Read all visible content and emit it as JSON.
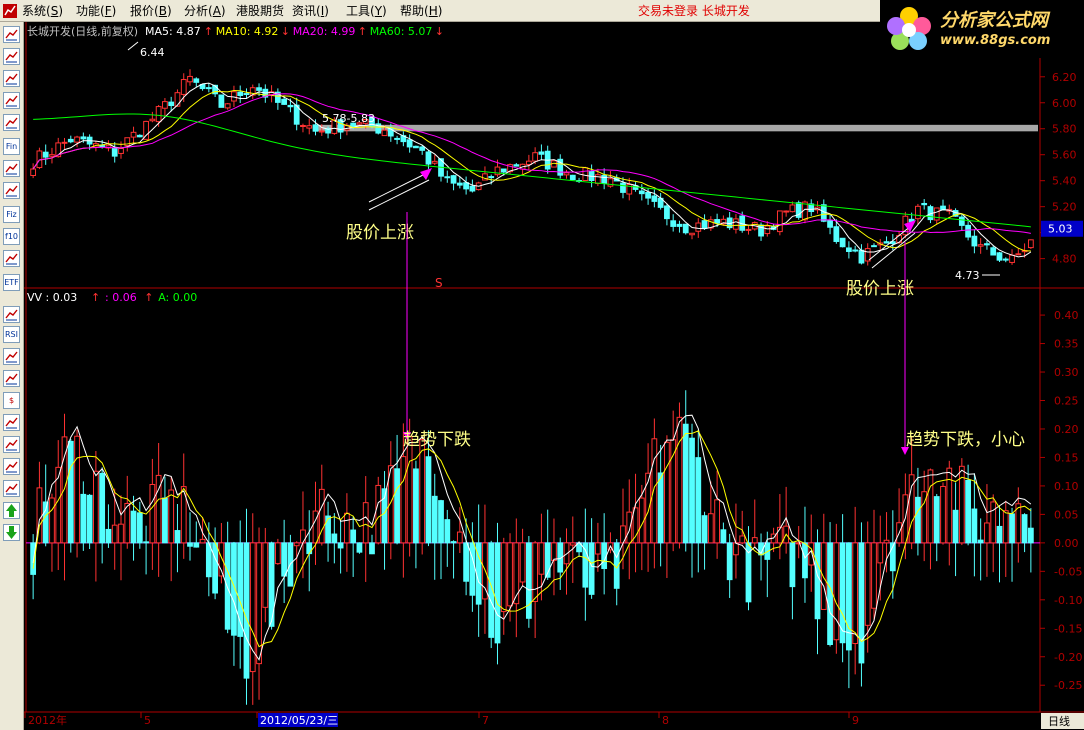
{
  "menu": {
    "items": [
      {
        "label": "系统",
        "key": "S"
      },
      {
        "label": "功能",
        "key": "F"
      },
      {
        "label": "报价",
        "key": "B"
      },
      {
        "label": "分析",
        "key": "A"
      },
      {
        "label": "港股期货",
        "key": ""
      },
      {
        "label": "资讯",
        "key": "I"
      },
      {
        "label": "工具",
        "key": "Y"
      },
      {
        "label": "帮助",
        "key": "H"
      }
    ],
    "status": "交易未登录  长城开发"
  },
  "logo": {
    "title": "分析家公式网",
    "url": "www.88gs.com"
  },
  "toolbar": {
    "icons": [
      "grid-icon",
      "list-icon",
      "line-chart-icon",
      "candle-icon",
      "layers-icon",
      "fin-icon",
      "f10-icon",
      "report-icon",
      "fiz-icon",
      "f10b-icon",
      "search-icon",
      "etf-icon",
      "wave-icon",
      "rsi-icon",
      "refresh-icon",
      "table-icon",
      "dollar-icon",
      "ticket-icon",
      "export-icon",
      "pencil-icon",
      "move-icon",
      "up-arrow-icon",
      "down-arrow-icon"
    ],
    "labels": [
      "",
      "",
      "",
      "",
      "",
      "Fin",
      "",
      "",
      "Fiz",
      "f10",
      "",
      "ETF",
      "",
      "RSI",
      "",
      "",
      "$",
      "",
      "",
      "",
      "",
      "",
      ""
    ]
  },
  "price_panel": {
    "title": "长城开发(日线,前复权)",
    "ma": [
      {
        "label": "MA5: 4.87",
        "arrow": "↑",
        "color": "#ffffff"
      },
      {
        "label": "MA10: 4.92",
        "arrow": "↓",
        "color": "#ffff00"
      },
      {
        "label": "MA20: 4.99",
        "arrow": "↑",
        "color": "#ff00ff"
      },
      {
        "label": "MA60: 5.07",
        "arrow": "↓",
        "color": "#00ff00"
      }
    ],
    "yticks": [
      "6.20",
      "6.00",
      "5.80",
      "5.60",
      "5.40",
      "5.20",
      "5.00",
      "4.80"
    ],
    "ylim": [
      4.62,
      6.36
    ],
    "current_price": "5.03",
    "high_label": "6.44",
    "low_label": "4.73",
    "range_label": "5.78-5.83",
    "annotation_rise_1": "股价上涨",
    "annotation_rise_2": "股价上涨",
    "marker": "S"
  },
  "indicator_panel": {
    "title_parts": [
      {
        "text": "VV  : 0.03",
        "arrow": "↑",
        "color": "#ffffff"
      },
      {
        "text": ": 0.06",
        "arrow": "↑",
        "color": "#ff00ff"
      },
      {
        "text": "A: 0.00",
        "arrow": "",
        "color": "#00ff00"
      }
    ],
    "yticks": [
      "0.40",
      "0.35",
      "0.30",
      "0.25",
      "0.20",
      "0.15",
      "0.10",
      "0.05",
      "0.00",
      "-0.05",
      "-0.10",
      "-0.15",
      "-0.20",
      "-0.25"
    ],
    "ylim": [
      -0.29,
      0.43
    ],
    "annotation_fall_1": "趋势下跌",
    "annotation_fall_2": "趋势下跌，小心"
  },
  "xaxis": {
    "labels": [
      {
        "text": "2012年",
        "highlight": false
      },
      {
        "text": "5",
        "highlight": false
      },
      {
        "text": "2012/05/23/三",
        "highlight": true
      },
      {
        "text": "7",
        "highlight": false
      },
      {
        "text": "8",
        "highlight": false
      },
      {
        "text": "9",
        "highlight": false
      }
    ],
    "period": "日线"
  },
  "colors": {
    "up": "#ff3232",
    "down": "#54ffff",
    "axis": "#b00000",
    "ma5": "#ffffff",
    "ma10": "#ffff00",
    "ma20": "#ff00ff",
    "ma60": "#00ff00",
    "resistance": "#a8a8a8",
    "annotation": "#ffff88",
    "annotation_line": "#ff00ff"
  },
  "chart_data": {
    "type": "candlestick",
    "title": "长城开发(日线,前复权)",
    "x_range": [
      "2012年",
      "9"
    ],
    "price_series": {
      "count": 132,
      "approx_close_path": [
        {
          "label": "2012年",
          "close": 5.55
        },
        {
          "label": "5",
          "close": 6.05
        },
        {
          "label": "2012/05/23/三",
          "close": 5.82
        },
        {
          "label": "7",
          "close": 5.45
        },
        {
          "label": "8",
          "close": 5.12
        },
        {
          "label": "9",
          "close": 5.1
        }
      ],
      "high": 6.44,
      "low": 4.73,
      "last": 5.03
    },
    "ma": {
      "MA5": 4.87,
      "MA10": 4.92,
      "MA20": 4.99,
      "MA60": 5.07
    },
    "indicator": {
      "VV": 0.03,
      "second": 0.06,
      "A": 0.0,
      "range": [
        -0.28,
        0.42
      ]
    }
  }
}
